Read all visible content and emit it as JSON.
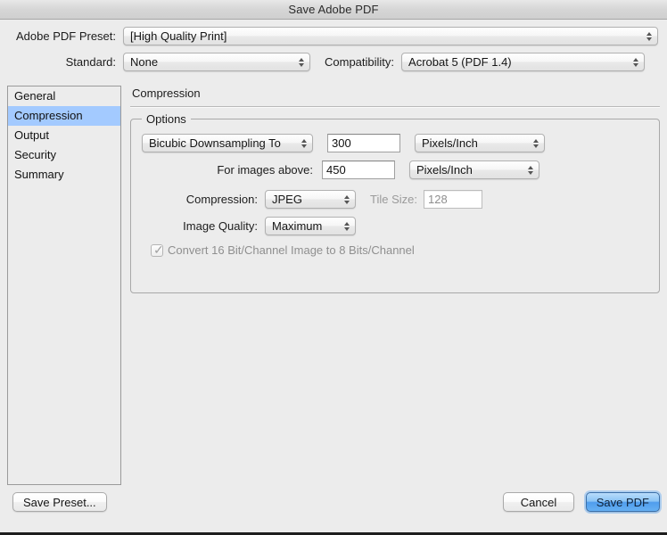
{
  "window": {
    "title": "Save Adobe PDF"
  },
  "top_form": {
    "preset_label": "Adobe PDF Preset:",
    "preset_value": "[High Quality Print]",
    "standard_label": "Standard:",
    "standard_value": "None",
    "compatibility_label": "Compatibility:",
    "compatibility_value": "Acrobat 5 (PDF 1.4)"
  },
  "sidebar": {
    "items": [
      {
        "label": "General",
        "selected": false
      },
      {
        "label": "Compression",
        "selected": true
      },
      {
        "label": "Output",
        "selected": false
      },
      {
        "label": "Security",
        "selected": false
      },
      {
        "label": "Summary",
        "selected": false
      }
    ]
  },
  "panel": {
    "title": "Compression",
    "group": {
      "legend": "Options",
      "sampling_value": "Bicubic Downsampling To",
      "resolution_value": "300",
      "resolution_units": "Pixels/Inch",
      "images_above_label": "For images above:",
      "images_above_value": "450",
      "images_above_units": "Pixels/Inch",
      "compression_label": "Compression:",
      "compression_value": "JPEG",
      "tile_size_label": "Tile Size:",
      "tile_size_value": "128",
      "image_quality_label": "Image Quality:",
      "image_quality_value": "Maximum",
      "convert_bits_label": "Convert 16 Bit/Channel Image to 8 Bits/Channel",
      "convert_bits_checked": "✓"
    }
  },
  "footer": {
    "save_preset_label": "Save Preset...",
    "cancel_label": "Cancel",
    "save_pdf_label": "Save PDF"
  },
  "colors": {
    "window_background": "#ececec",
    "selection_blue": "#a3caff",
    "default_button_blue": "#4f9ded",
    "disabled_text": "#8f8f8f"
  }
}
